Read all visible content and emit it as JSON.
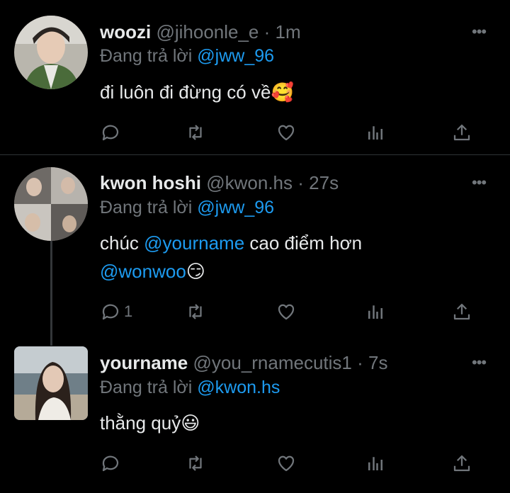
{
  "tweets": [
    {
      "name": "woozi",
      "handle": "@jihoonle_e",
      "sep": "·",
      "time": "1m",
      "reply_prefix": "Đang trả lời",
      "reply_to": "@jww_96",
      "text_parts": [
        "đi luôn đi đừng có về",
        "🥰"
      ],
      "reply_count": "",
      "avatar_icon": "avatar-photo"
    },
    {
      "name": "kwon hoshi",
      "handle": "@kwon.hs",
      "sep": "·",
      "time": "27s",
      "reply_prefix": "Đang trả lời",
      "reply_to": "@jww_96",
      "text_parts": [
        "chúc ",
        "@yourname",
        " cao điểm hơn",
        "@wonwoo",
        "😏"
      ],
      "reply_count": "1",
      "avatar_icon": "avatar-photo"
    },
    {
      "name": "yourname",
      "handle": "@you_rnamecutis1",
      "sep": "·",
      "time": "7s",
      "reply_prefix": "Đang trả lời",
      "reply_to": "@kwon.hs",
      "text_parts": [
        "thằng quỷ",
        "😃"
      ],
      "reply_count": "",
      "avatar_icon": "avatar-photo"
    }
  ],
  "more_label": "•••",
  "colors": {
    "background": "#000000",
    "accent": "#1d9bf0",
    "muted": "#71767b",
    "text": "#e7e9ea"
  },
  "icons": [
    "reply-icon",
    "retweet-icon",
    "like-icon",
    "views-icon",
    "share-icon",
    "more-icon"
  ]
}
